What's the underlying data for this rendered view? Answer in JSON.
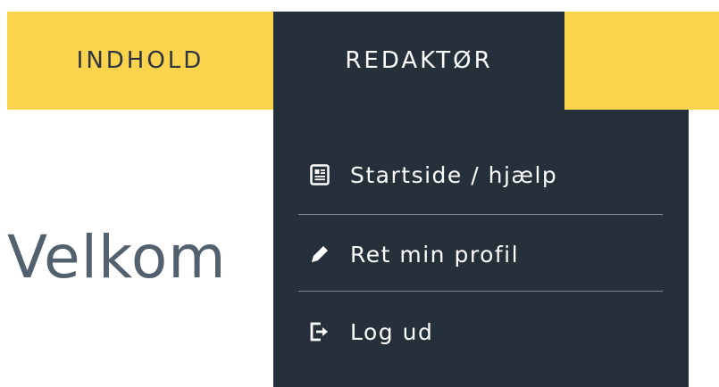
{
  "navbar": {
    "items": [
      {
        "label": "INDHOLD"
      },
      {
        "label": "REDAKTØR"
      }
    ]
  },
  "main": {
    "welcome_text": "Velkom"
  },
  "dropdown": {
    "items": [
      {
        "label": "Startside / hjælp",
        "icon": "document-icon"
      },
      {
        "label": "Ret min profil",
        "icon": "pencil-icon"
      },
      {
        "label": "Log ud",
        "icon": "logout-icon"
      }
    ]
  },
  "colors": {
    "navbar_bg": "#fbd34d",
    "dark": "#25303a",
    "welcome_text": "#53606d"
  }
}
